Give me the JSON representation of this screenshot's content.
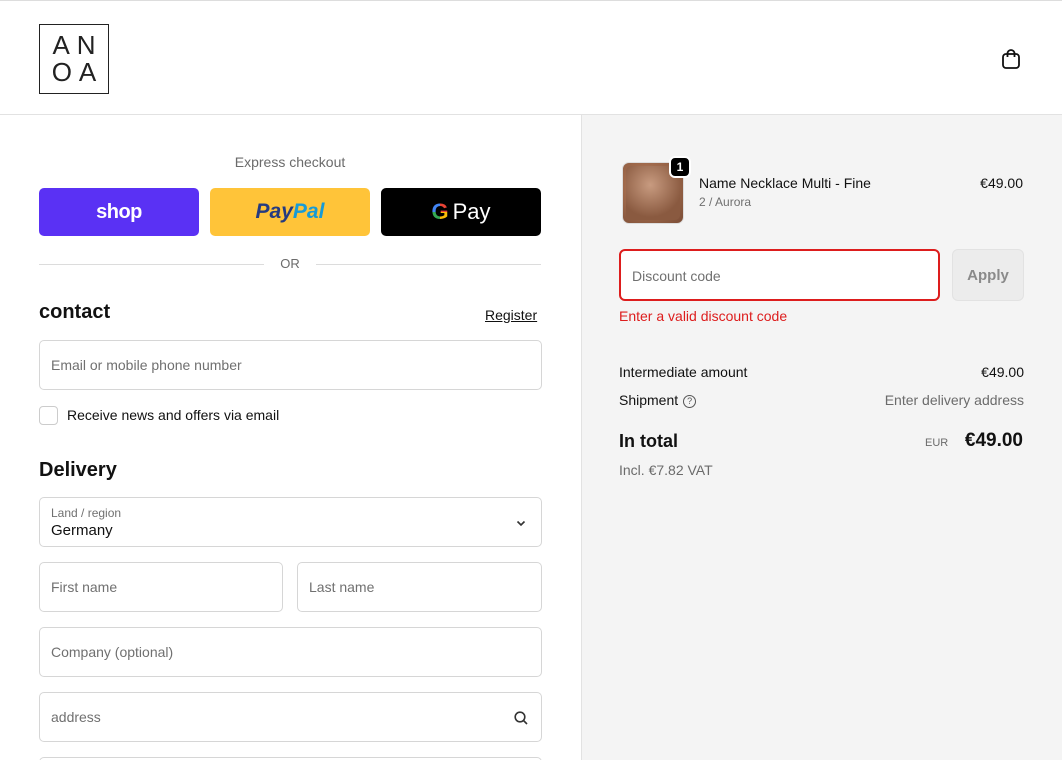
{
  "header": {
    "logo_line1": "AN",
    "logo_line2": "OA",
    "cart_icon": "shopping-bag-icon"
  },
  "express": {
    "label": "Express checkout",
    "shop_label": "shop",
    "paypal_label_a": "Pay",
    "paypal_label_b": "Pal",
    "gpay_g": "G",
    "gpay_label": "Pay",
    "or_label": "OR"
  },
  "contact": {
    "title": "contact",
    "register_link": "Register",
    "email_placeholder": "Email or mobile phone number",
    "newsletter_label": "Receive news and offers via email"
  },
  "delivery": {
    "title": "Delivery",
    "country_label": "Land / region",
    "country_value": "Germany",
    "first_name_placeholder": "First name",
    "last_name_placeholder": "Last name",
    "company_placeholder": "Company (optional)",
    "address_placeholder": "address"
  },
  "order": {
    "quantity": "1",
    "product_name": "Name Necklace Multi - Fine",
    "product_variant": "2 / Aurora",
    "product_price": "€49.00",
    "discount_placeholder": "Discount code",
    "apply_label": "Apply",
    "discount_error": "Enter a valid discount code",
    "subtotal_label": "Intermediate amount",
    "subtotal_value": "€49.00",
    "shipping_label": "Shipment",
    "shipping_value": "Enter delivery address",
    "total_label": "In total",
    "total_currency": "EUR",
    "total_value": "€49.00",
    "vat_note": "Incl. €7.82 VAT"
  },
  "colors": {
    "shop_purple": "#5a31f4",
    "paypal_yellow": "#ffc439",
    "error_red": "#dd1d1d"
  }
}
